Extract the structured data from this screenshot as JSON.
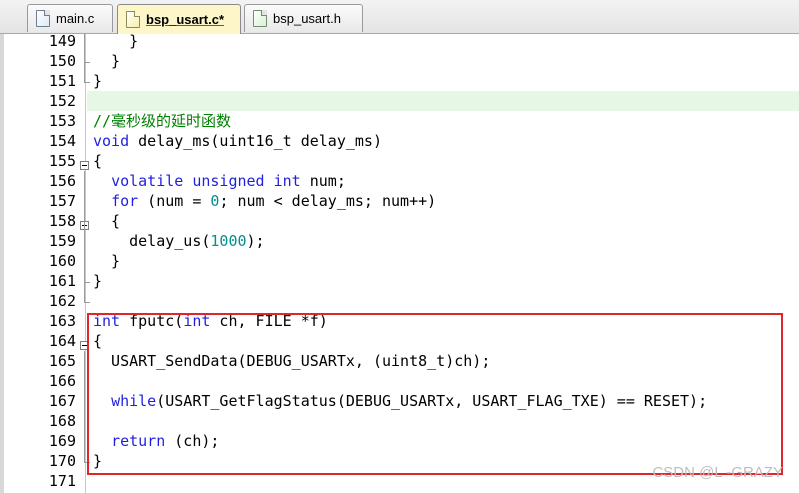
{
  "tabs": [
    {
      "label": "main.c",
      "icon": "c-file-icon",
      "active": false
    },
    {
      "label": "bsp_usart.c*",
      "icon": "c-file-icon",
      "active": true
    },
    {
      "label": "bsp_usart.h",
      "icon": "h-file-icon",
      "active": false
    }
  ],
  "editor": {
    "current_line": "152",
    "lines": [
      {
        "n": "149",
        "tokens": [
          {
            "t": "    }",
            "c": ""
          }
        ]
      },
      {
        "n": "150",
        "tokens": [
          {
            "t": "  }",
            "c": ""
          }
        ]
      },
      {
        "n": "151",
        "tokens": [
          {
            "t": "}",
            "c": ""
          }
        ]
      },
      {
        "n": "152",
        "tokens": []
      },
      {
        "n": "153",
        "tokens": [
          {
            "t": "//毫秒级的延时函数",
            "c": "cm"
          }
        ]
      },
      {
        "n": "154",
        "tokens": [
          {
            "t": "void",
            "c": "kw"
          },
          {
            "t": " delay_ms(uint16_t delay_ms)",
            "c": ""
          }
        ]
      },
      {
        "n": "155",
        "tokens": [
          {
            "t": "{",
            "c": ""
          }
        ]
      },
      {
        "n": "156",
        "tokens": [
          {
            "t": "  ",
            "c": ""
          },
          {
            "t": "volatile",
            "c": "kw"
          },
          {
            "t": " ",
            "c": ""
          },
          {
            "t": "unsigned",
            "c": "kw"
          },
          {
            "t": " ",
            "c": ""
          },
          {
            "t": "int",
            "c": "kw"
          },
          {
            "t": " num;",
            "c": ""
          }
        ]
      },
      {
        "n": "157",
        "tokens": [
          {
            "t": "  ",
            "c": ""
          },
          {
            "t": "for",
            "c": "kw"
          },
          {
            "t": " (num = ",
            "c": ""
          },
          {
            "t": "0",
            "c": "num"
          },
          {
            "t": "; num < delay_ms; num++)",
            "c": ""
          }
        ]
      },
      {
        "n": "158",
        "tokens": [
          {
            "t": "  {",
            "c": ""
          }
        ]
      },
      {
        "n": "159",
        "tokens": [
          {
            "t": "    delay_us(",
            "c": ""
          },
          {
            "t": "1000",
            "c": "num"
          },
          {
            "t": ");",
            "c": ""
          }
        ]
      },
      {
        "n": "160",
        "tokens": [
          {
            "t": "  }",
            "c": ""
          }
        ]
      },
      {
        "n": "161",
        "tokens": [
          {
            "t": "}",
            "c": ""
          }
        ]
      },
      {
        "n": "162",
        "tokens": []
      },
      {
        "n": "163",
        "tokens": [
          {
            "t": "int",
            "c": "kw"
          },
          {
            "t": " fputc(",
            "c": ""
          },
          {
            "t": "int",
            "c": "kw"
          },
          {
            "t": " ch, FILE *f)",
            "c": ""
          }
        ]
      },
      {
        "n": "164",
        "tokens": [
          {
            "t": "{",
            "c": ""
          }
        ]
      },
      {
        "n": "165",
        "tokens": [
          {
            "t": "  USART_SendData(DEBUG_USARTx, (uint8_t)ch);",
            "c": ""
          }
        ]
      },
      {
        "n": "166",
        "tokens": []
      },
      {
        "n": "167",
        "tokens": [
          {
            "t": "  ",
            "c": ""
          },
          {
            "t": "while",
            "c": "kw"
          },
          {
            "t": "(USART_GetFlagStatus(DEBUG_USARTx, USART_FLAG_TXE) == RESET);",
            "c": ""
          }
        ]
      },
      {
        "n": "168",
        "tokens": []
      },
      {
        "n": "169",
        "tokens": [
          {
            "t": "  ",
            "c": ""
          },
          {
            "t": "return",
            "c": "kw"
          },
          {
            "t": " (ch);",
            "c": ""
          }
        ]
      },
      {
        "n": "170",
        "tokens": [
          {
            "t": "}",
            "c": ""
          }
        ]
      },
      {
        "n": "171",
        "tokens": []
      }
    ]
  },
  "colors": {
    "keyword": "#1f1fe0",
    "comment": "#008000",
    "number": "#009090",
    "current_line_bg": "#e6f7e6",
    "highlight_box": "#e0262b"
  },
  "watermark": "CSDN @L -GRAZY"
}
